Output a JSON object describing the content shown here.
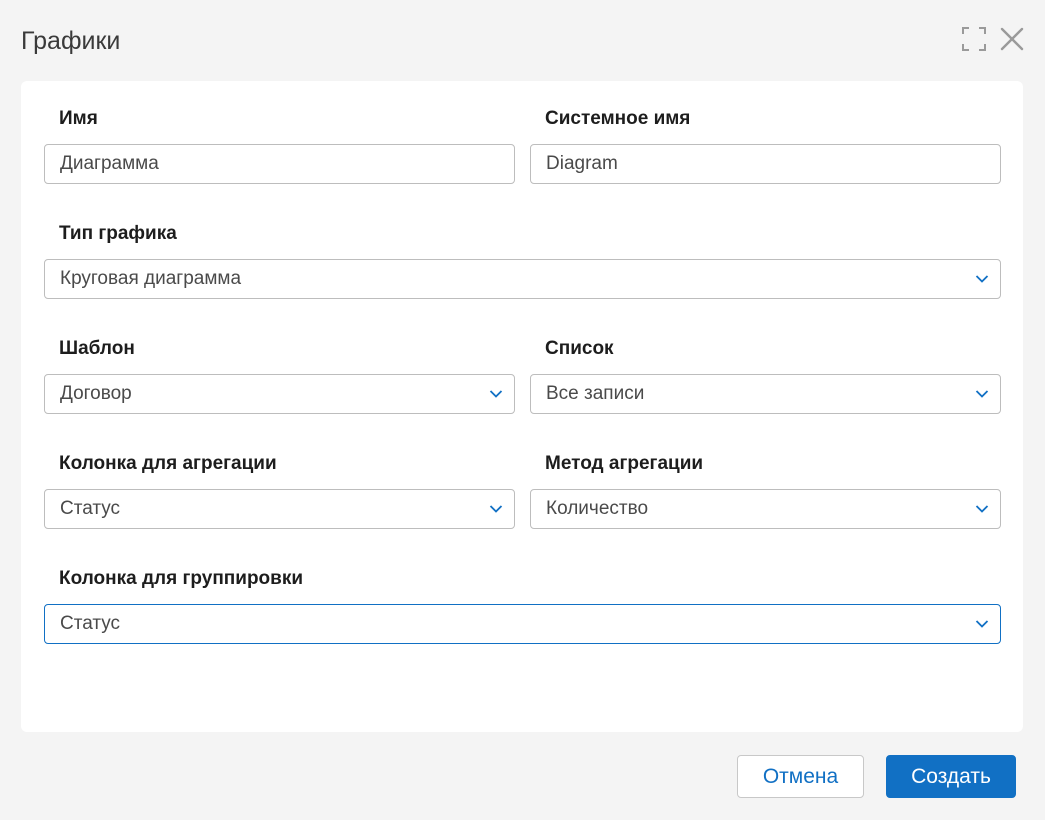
{
  "dialog": {
    "title": "Графики"
  },
  "icons": {
    "expand": "expand-icon",
    "close": "close-icon",
    "chevron": "chevron-down-icon"
  },
  "form": {
    "name": {
      "label": "Имя",
      "value": "Диаграмма"
    },
    "system_name": {
      "label": "Системное имя",
      "value": "Diagram"
    },
    "chart_type": {
      "label": "Тип графика",
      "value": "Круговая диаграмма"
    },
    "template": {
      "label": "Шаблон",
      "value": "Договор"
    },
    "list": {
      "label": "Список",
      "value": "Все записи"
    },
    "aggregation_column": {
      "label": "Колонка для агрегации",
      "value": "Статус"
    },
    "aggregation_method": {
      "label": "Метод агрегации",
      "value": "Количество"
    },
    "grouping_column": {
      "label": "Колонка для группировки",
      "value": "Статус"
    }
  },
  "buttons": {
    "cancel": "Отмена",
    "create": "Создать"
  },
  "colors": {
    "accent": "#1170c4",
    "border": "#bdbdbd",
    "background": "#f4f4f4"
  }
}
